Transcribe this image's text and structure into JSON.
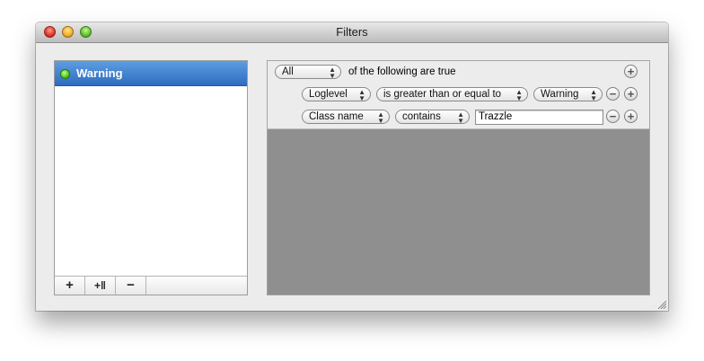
{
  "window": {
    "title": "Filters"
  },
  "filters_list": {
    "items": [
      {
        "label": "Warning",
        "status_color": "#3fbf12"
      }
    ],
    "toolbar": {
      "add_label": "+",
      "add_group_label": "+‖",
      "remove_label": "−"
    }
  },
  "rules": {
    "header": {
      "match_mode": "All",
      "text": "of the following are true",
      "add_label": "+"
    },
    "rows": [
      {
        "field": "Loglevel",
        "operator": "is greater than or equal to",
        "value": "Warning",
        "remove_label": "−",
        "add_label": "+"
      },
      {
        "field": "Class name",
        "operator": "contains",
        "value": "Trazzle",
        "remove_label": "−",
        "add_label": "+"
      }
    ]
  },
  "colors": {
    "selection": "#3a7ad0",
    "empty_area": "#8f8f8f"
  }
}
